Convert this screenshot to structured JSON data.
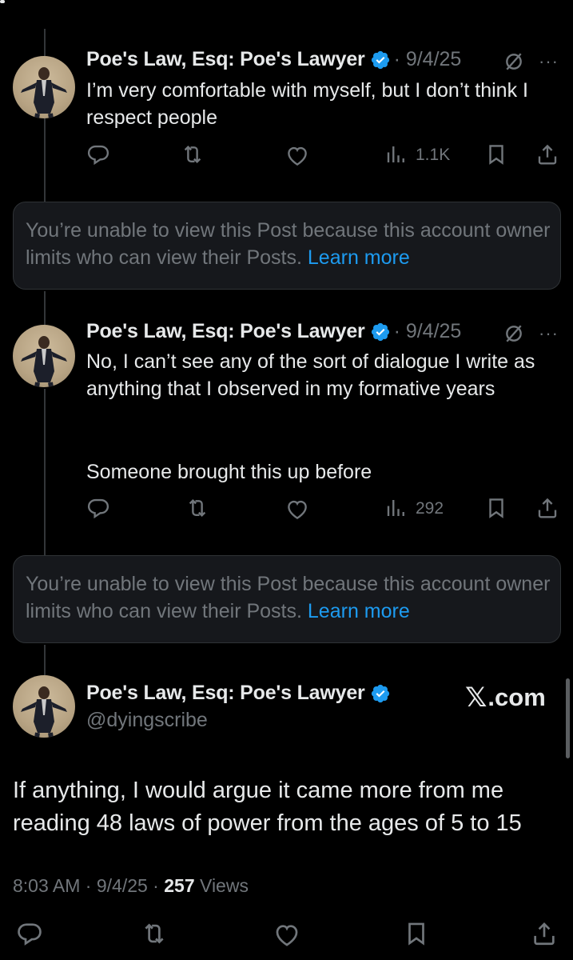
{
  "posts": [
    {
      "name": "Poe's Law, Esq: Poe's Lawyer",
      "date": "· 9/4/25",
      "more": "···",
      "text": "I’m very comfortable with myself, but I don’t think I respect people",
      "views": "1.1K"
    },
    {
      "name": "Poe's Law, Esq: Poe's Lawyer",
      "date": "· 9/4/25",
      "more": "···",
      "text_line1": "No, I can’t see any of the sort of dialogue I write as anything that I observed in my formative years",
      "text_line2": "Someone brought this up before",
      "views": "292"
    }
  ],
  "unavailable": {
    "message": "You’re unable to view this Post because this account owner limits who can view their Posts.",
    "link": "Learn more"
  },
  "main_post": {
    "name": "Poe's Law, Esq: Poe's Lawyer",
    "handle": "@dyingscribe",
    "brand_mark": "𝕏",
    "brand_text": ".com",
    "text": "If anything, I would argue it came more from me reading 48 laws of power from the ages of 5 to 15",
    "time": "8:03 AM",
    "date": "9/4/25",
    "views_count": "257",
    "views_label": "Views"
  },
  "colors": {
    "background": "#000000",
    "text": "#e7e9ea",
    "muted": "#71767b",
    "link": "#1d9bf0",
    "verified": "#1d9bf0"
  }
}
